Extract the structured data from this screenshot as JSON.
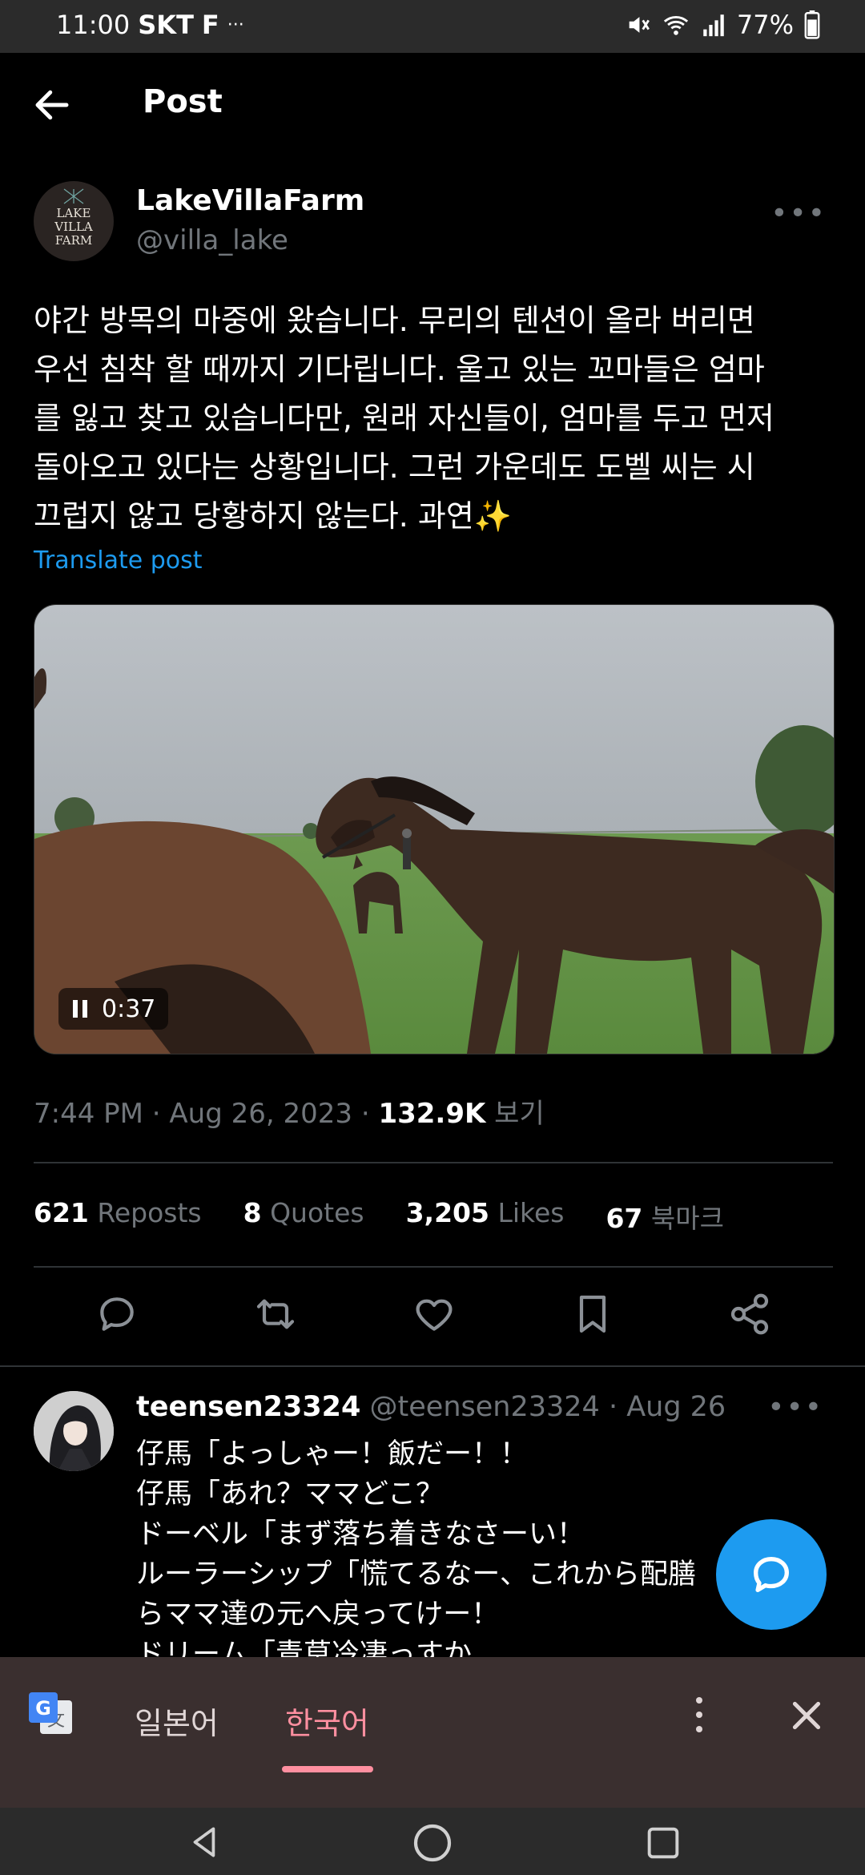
{
  "status_bar": {
    "time": "11:00",
    "carrier": "SKT",
    "extra": "F",
    "more": "···",
    "battery": "77%"
  },
  "header": {
    "title": "Post"
  },
  "post": {
    "author_name": "LakeVillaFarm",
    "author_handle": "@villa_lake",
    "avatar_text": [
      "LAKE",
      "VILLA",
      "FARM"
    ],
    "text_lines": [
      "야간 방목의 마중에 왔습니다. 무리의 텐션이 올라 버리면",
      "우선 침착 할 때까지 기다립니다. 울고 있는 꼬마들은 엄마",
      "를 잃고 찾고 있습니다만, 원래 자신들이, 엄마를 두고 먼저",
      "돌아오고 있다는 상황입니다. 그런 가운데도 도벨 씨는 시",
      "끄럽지 않고 당황하지 않는다. 과연✨"
    ],
    "translate_label": "Translate post",
    "video_time": "0:37",
    "timestamp": "7:44 PM · Aug 26, 2023 · ",
    "views_count": "132.9K",
    "views_label": " 보기",
    "stats": {
      "reposts_count": "621",
      "reposts_label": "Reposts",
      "quotes_count": "8",
      "quotes_label": "Quotes",
      "likes_count": "3,205",
      "likes_label": "Likes",
      "bookmarks_count": "67",
      "bookmarks_label": "북마크"
    }
  },
  "reply": {
    "name": "teensen23324",
    "handle": "@teensen23324",
    "date": "· Aug 26",
    "lines": [
      "仔馬「よっしゃー！飯だー！！",
      "仔馬「あれ？ママどこ？",
      "ドーベル「まず落ち着きなさーい！",
      "ルーラーシップ「慌てるなー、これから配膳",
      "らママ達の元へ戻ってけー！",
      "ドリーム「青草冷凄っすか"
    ]
  },
  "translate_bar": {
    "lang_from": "일본어",
    "lang_to": "한국어"
  },
  "colors": {
    "accent": "#1d9bf0",
    "background": "#000000",
    "muted": "#71767b",
    "translate_active": "#ff8fa0"
  }
}
